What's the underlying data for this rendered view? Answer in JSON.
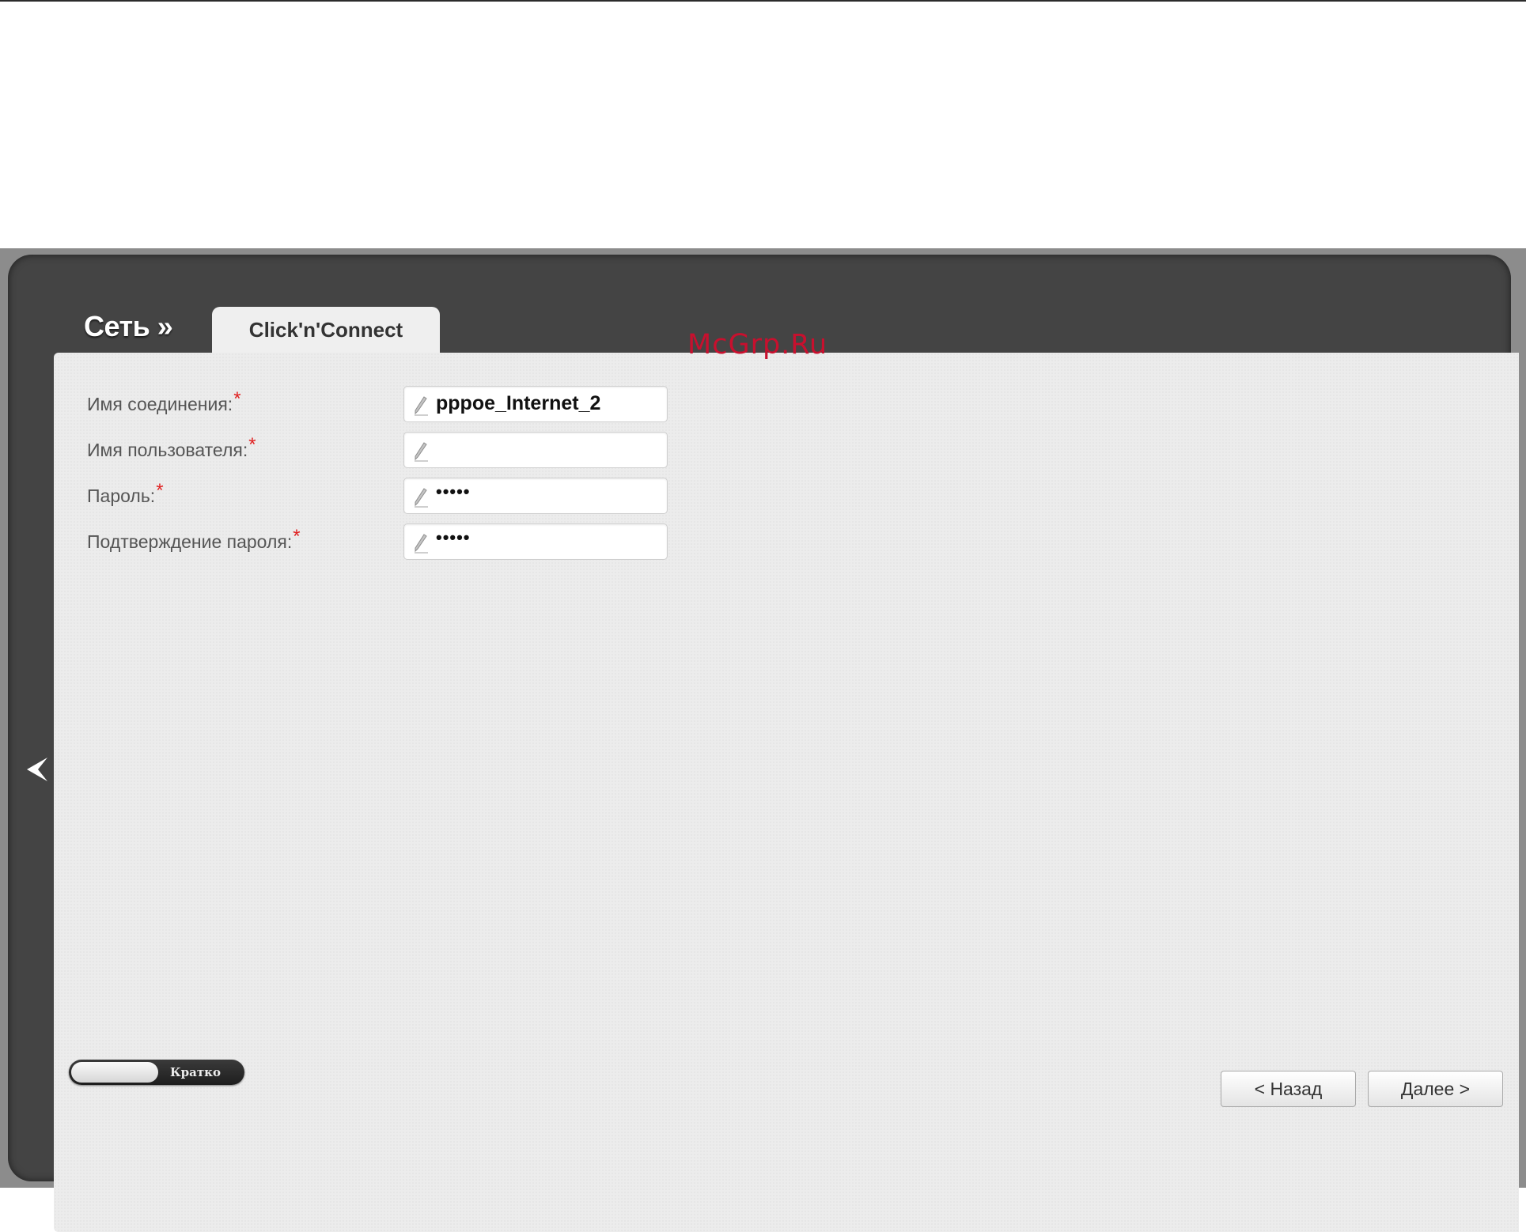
{
  "header": {
    "section_title": "Сеть »",
    "active_tab": "Click'n'Connect"
  },
  "form": {
    "fields": [
      {
        "label": "Имя соединения:",
        "required_mark": "*",
        "value": "pppoe_Internet_2",
        "type": "text"
      },
      {
        "label": "Имя пользователя:",
        "required_mark": "*",
        "value": "",
        "type": "text"
      },
      {
        "label": "Пароль:",
        "required_mark": "*",
        "value": "•••••",
        "type": "password"
      },
      {
        "label": "Подтверждение пароля:",
        "required_mark": "*",
        "value": "•••••",
        "type": "password"
      }
    ]
  },
  "watermark": "McGrp.Ru",
  "footer": {
    "mode_toggle_label": "Кратко",
    "back_button": "< Назад",
    "next_button": "Далее >"
  },
  "colors": {
    "frame": "#444444",
    "panel": "#ececec",
    "required": "#e02020",
    "watermark": "#c8102e"
  },
  "icons": {
    "field_icon": "pencil-icon",
    "sidebar_toggle": "chevron-left-icon"
  }
}
